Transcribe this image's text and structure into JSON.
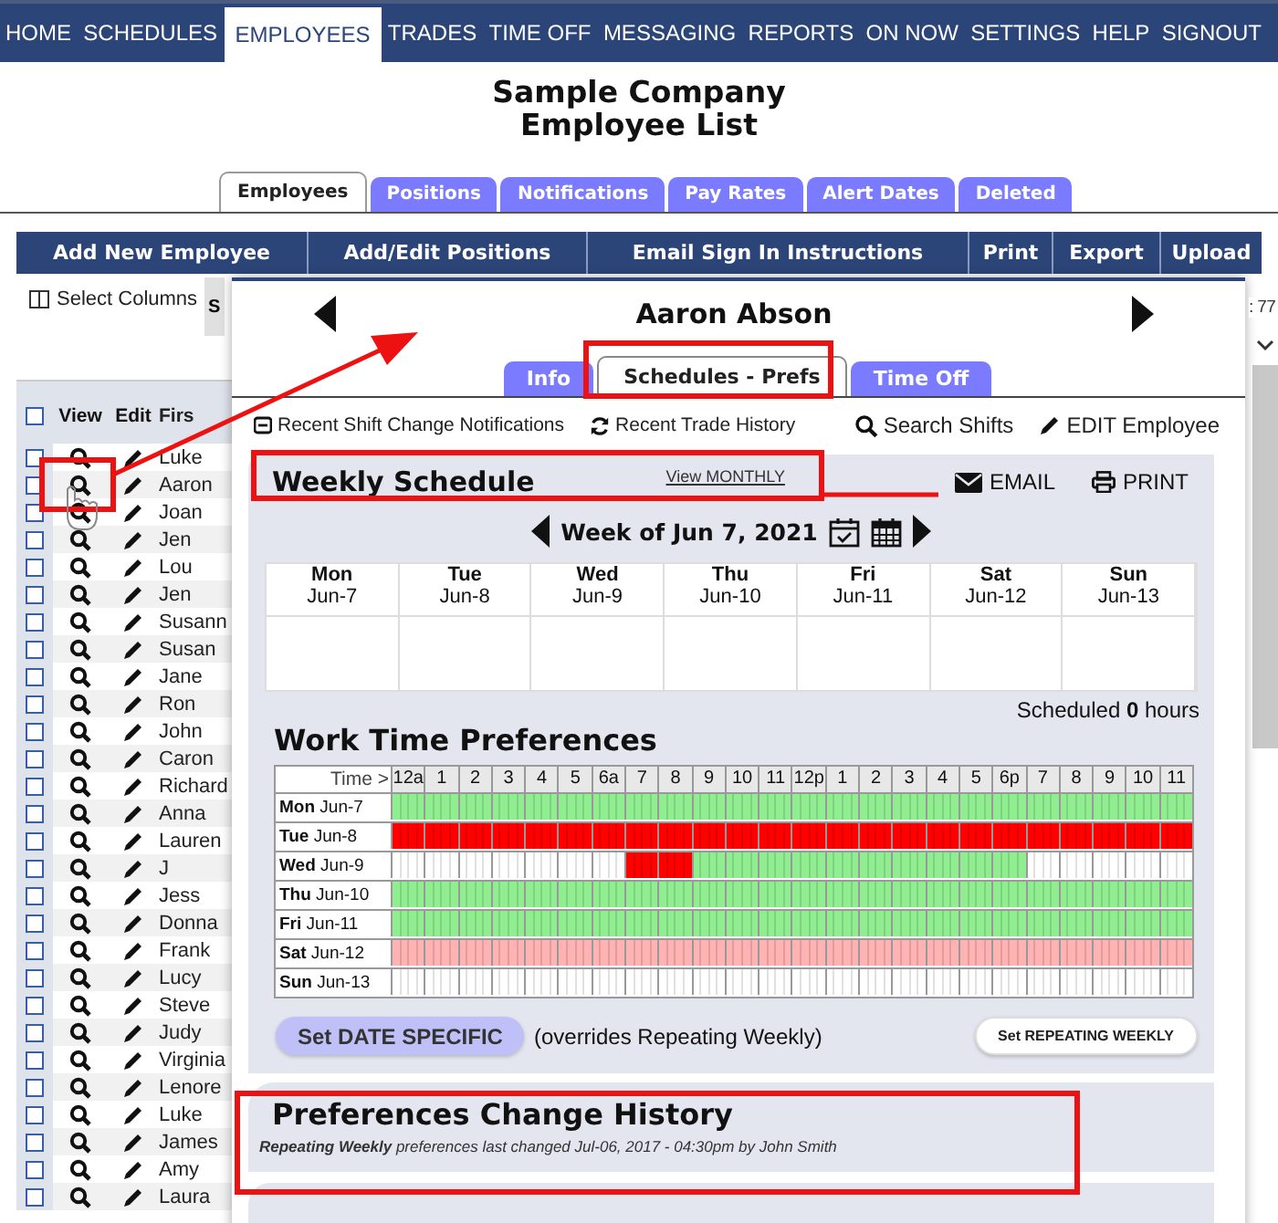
{
  "nav": [
    {
      "label": "HOME",
      "selected": false
    },
    {
      "label": "SCHEDULES",
      "selected": false
    },
    {
      "label": "EMPLOYEES",
      "selected": true
    },
    {
      "label": "TRADES",
      "selected": false
    },
    {
      "label": "TIME OFF",
      "selected": false
    },
    {
      "label": "MESSAGING",
      "selected": false
    },
    {
      "label": "REPORTS",
      "selected": false
    },
    {
      "label": "ON NOW",
      "selected": false
    },
    {
      "label": "SETTINGS",
      "selected": false
    },
    {
      "label": "HELP",
      "selected": false
    },
    {
      "label": "SIGNOUT",
      "selected": false
    }
  ],
  "page": {
    "company": "Sample Company",
    "title": "Employee List"
  },
  "tabs": [
    {
      "label": "Employees",
      "selected": true
    },
    {
      "label": "Positions",
      "selected": false
    },
    {
      "label": "Notifications",
      "selected": false
    },
    {
      "label": "Pay Rates",
      "selected": false
    },
    {
      "label": "Alert Dates",
      "selected": false
    },
    {
      "label": "Deleted",
      "selected": false
    }
  ],
  "toolbar": [
    "Add New Employee",
    "Add/Edit Positions",
    "Email Sign In Instructions",
    "Print",
    "Export",
    "Upload"
  ],
  "select_columns": "Select Columns",
  "cut_button": "S",
  "count_fragment": ": 77",
  "employees": {
    "columns": [
      "View",
      "Edit",
      "Firs"
    ],
    "all_checked": false,
    "rows": [
      {
        "first": "Luke",
        "checked": false
      },
      {
        "first": "Aaron",
        "checked": false
      },
      {
        "first": "Joan",
        "checked": false
      },
      {
        "first": "Jen",
        "checked": false
      },
      {
        "first": "Lou",
        "checked": false
      },
      {
        "first": "Jen",
        "checked": false
      },
      {
        "first": "Susann",
        "checked": false
      },
      {
        "first": "Susan",
        "checked": false
      },
      {
        "first": "Jane",
        "checked": false
      },
      {
        "first": "Ron",
        "checked": false
      },
      {
        "first": "John",
        "checked": false
      },
      {
        "first": "Caron",
        "checked": false
      },
      {
        "first": "Richard",
        "checked": false
      },
      {
        "first": "Anna",
        "checked": false
      },
      {
        "first": "Lauren",
        "checked": false
      },
      {
        "first": "J",
        "checked": false
      },
      {
        "first": "Jess",
        "checked": false
      },
      {
        "first": "Donna",
        "checked": false
      },
      {
        "first": "Frank",
        "checked": false
      },
      {
        "first": "Lucy",
        "checked": false
      },
      {
        "first": "Steve",
        "checked": false
      },
      {
        "first": "Judy",
        "checked": false
      },
      {
        "first": "Virginia",
        "checked": false
      },
      {
        "first": "Lenore",
        "checked": false
      },
      {
        "first": "Luke",
        "checked": false
      },
      {
        "first": "James",
        "checked": false
      },
      {
        "first": "Amy",
        "checked": false
      },
      {
        "first": "Laura",
        "checked": false
      }
    ]
  },
  "popup": {
    "name": "Aaron Abson",
    "tabs": [
      {
        "label": "Info",
        "selected": false
      },
      {
        "label": "Schedules - Prefs",
        "selected": true
      },
      {
        "label": "Time Off",
        "selected": false
      }
    ],
    "links": [
      {
        "kind": "notification",
        "label": "Recent Shift Change Notifications"
      },
      {
        "kind": "refresh",
        "label": "Recent Trade History"
      },
      {
        "kind": "search",
        "label": "Search Shifts"
      },
      {
        "kind": "edit",
        "label": "EDIT Employee"
      }
    ],
    "weekly": {
      "title": "Weekly Schedule",
      "view_link": "View MONTHLY",
      "actions": [
        {
          "kind": "email",
          "label": "EMAIL"
        },
        {
          "kind": "print",
          "label": "PRINT"
        }
      ],
      "week": "Week of Jun 7, 2021",
      "days": [
        {
          "day": "Mon",
          "date": "Jun-7"
        },
        {
          "day": "Tue",
          "date": "Jun-8"
        },
        {
          "day": "Wed",
          "date": "Jun-9"
        },
        {
          "day": "Thu",
          "date": "Jun-10"
        },
        {
          "day": "Fri",
          "date": "Jun-11"
        },
        {
          "day": "Sat",
          "date": "Jun-12"
        },
        {
          "day": "Sun",
          "date": "Jun-13"
        }
      ],
      "scheduled": "Scheduled **0** hours"
    },
    "preferences": {
      "title": "Work Time Preferences",
      "corner": "Time >",
      "hours": [
        "12a",
        "1",
        "2",
        "3",
        "4",
        "5",
        "6a",
        "7",
        "8",
        "9",
        "10",
        "11",
        "12p",
        "1",
        "2",
        "3",
        "4",
        "5",
        "6p",
        "7",
        "8",
        "9",
        "10",
        "11"
      ],
      "rows": [
        {
          "day": "Mon",
          "date": "Jun-7",
          "slots": [
            {
              "color": "#90ee90"
            },
            {
              "color": "#90ee90"
            },
            {
              "color": "#90ee90"
            },
            {
              "color": "#90ee90"
            },
            {
              "color": "#90ee90"
            },
            {
              "color": "#90ee90"
            },
            {
              "color": "#90ee90"
            },
            {
              "color": "#90ee90"
            },
            {
              "color": "#90ee90"
            },
            {
              "color": "#90ee90"
            },
            {
              "color": "#90ee90"
            },
            {
              "color": "#90ee90"
            },
            {
              "color": "#90ee90"
            },
            {
              "color": "#90ee90"
            },
            {
              "color": "#90ee90"
            },
            {
              "color": "#90ee90"
            },
            {
              "color": "#90ee90"
            },
            {
              "color": "#90ee90"
            },
            {
              "color": "#90ee90"
            },
            {
              "color": "#90ee90"
            },
            {
              "color": "#90ee90"
            },
            {
              "color": "#90ee90"
            },
            {
              "color": "#90ee90"
            },
            {
              "color": "#90ee90"
            }
          ]
        },
        {
          "day": "Tue",
          "date": "Jun-8",
          "slots": [
            {
              "color": "#ff0000"
            },
            {
              "color": "#ff0000"
            },
            {
              "color": "#ff0000"
            },
            {
              "color": "#ff0000"
            },
            {
              "color": "#ff0000"
            },
            {
              "color": "#ff0000"
            },
            {
              "color": "#ff0000"
            },
            {
              "color": "#ff0000"
            },
            {
              "color": "#ff0000"
            },
            {
              "color": "#ff0000"
            },
            {
              "color": "#ff0000"
            },
            {
              "color": "#ff0000"
            },
            {
              "color": "#ff0000"
            },
            {
              "color": "#ff0000"
            },
            {
              "color": "#ff0000"
            },
            {
              "color": "#ff0000"
            },
            {
              "color": "#ff0000"
            },
            {
              "color": "#ff0000"
            },
            {
              "color": "#ff0000"
            },
            {
              "color": "#ff0000"
            },
            {
              "color": "#ff0000"
            },
            {
              "color": "#ff0000"
            },
            {
              "color": "#ff0000"
            },
            {
              "color": "#ff0000"
            }
          ]
        },
        {
          "day": "Wed",
          "date": "Jun-9",
          "slots": [
            {
              "color": "#ffffff"
            },
            {
              "color": "#ffffff"
            },
            {
              "color": "#ffffff"
            },
            {
              "color": "#ffffff"
            },
            {
              "color": "#ffffff"
            },
            {
              "color": "#ffffff"
            },
            {
              "color": "#ffffff"
            },
            {
              "color": "#ff0000"
            },
            {
              "color": "#ff0000"
            },
            {
              "color": "#90ee90"
            },
            {
              "color": "#90ee90"
            },
            {
              "color": "#90ee90"
            },
            {
              "color": "#90ee90"
            },
            {
              "color": "#90ee90"
            },
            {
              "color": "#90ee90"
            },
            {
              "color": "#90ee90"
            },
            {
              "color": "#90ee90"
            },
            {
              "color": "#90ee90"
            },
            {
              "color": "#90ee90"
            },
            {
              "color": "#ffffff"
            },
            {
              "color": "#ffffff"
            },
            {
              "color": "#ffffff"
            },
            {
              "color": "#ffffff"
            },
            {
              "color": "#ffffff"
            }
          ]
        },
        {
          "day": "Thu",
          "date": "Jun-10",
          "slots": [
            {
              "color": "#90ee90"
            },
            {
              "color": "#90ee90"
            },
            {
              "color": "#90ee90"
            },
            {
              "color": "#90ee90"
            },
            {
              "color": "#90ee90"
            },
            {
              "color": "#90ee90"
            },
            {
              "color": "#90ee90"
            },
            {
              "color": "#90ee90"
            },
            {
              "color": "#90ee90"
            },
            {
              "color": "#90ee90"
            },
            {
              "color": "#90ee90"
            },
            {
              "color": "#90ee90"
            },
            {
              "color": "#90ee90"
            },
            {
              "color": "#90ee90"
            },
            {
              "color": "#90ee90"
            },
            {
              "color": "#90ee90"
            },
            {
              "color": "#90ee90"
            },
            {
              "color": "#90ee90"
            },
            {
              "color": "#90ee90"
            },
            {
              "color": "#90ee90"
            },
            {
              "color": "#90ee90"
            },
            {
              "color": "#90ee90"
            },
            {
              "color": "#90ee90"
            },
            {
              "color": "#90ee90"
            }
          ]
        },
        {
          "day": "Fri",
          "date": "Jun-11",
          "slots": [
            {
              "color": "#90ee90"
            },
            {
              "color": "#90ee90"
            },
            {
              "color": "#90ee90"
            },
            {
              "color": "#90ee90"
            },
            {
              "color": "#90ee90"
            },
            {
              "color": "#90ee90"
            },
            {
              "color": "#90ee90"
            },
            {
              "color": "#90ee90"
            },
            {
              "color": "#90ee90"
            },
            {
              "color": "#90ee90"
            },
            {
              "color": "#90ee90"
            },
            {
              "color": "#90ee90"
            },
            {
              "color": "#90ee90"
            },
            {
              "color": "#90ee90"
            },
            {
              "color": "#90ee90"
            },
            {
              "color": "#90ee90"
            },
            {
              "color": "#90ee90"
            },
            {
              "color": "#90ee90"
            },
            {
              "color": "#90ee90"
            },
            {
              "color": "#90ee90"
            },
            {
              "color": "#90ee90"
            },
            {
              "color": "#90ee90"
            },
            {
              "color": "#90ee90"
            },
            {
              "color": "#90ee90"
            }
          ]
        },
        {
          "day": "Sat",
          "date": "Jun-12",
          "slots": [
            {
              "color": "#ffb3b3"
            },
            {
              "color": "#ffb3b3"
            },
            {
              "color": "#ffb3b3"
            },
            {
              "color": "#ffb3b3"
            },
            {
              "color": "#ffb3b3"
            },
            {
              "color": "#ffb3b3"
            },
            {
              "color": "#ffb3b3"
            },
            {
              "color": "#ffb3b3"
            },
            {
              "color": "#ffb3b3"
            },
            {
              "color": "#ffb3b3"
            },
            {
              "color": "#ffb3b3"
            },
            {
              "color": "#ffb3b3"
            },
            {
              "color": "#ffb3b3"
            },
            {
              "color": "#ffb3b3"
            },
            {
              "color": "#ffb3b3"
            },
            {
              "color": "#ffb3b3"
            },
            {
              "color": "#ffb3b3"
            },
            {
              "color": "#ffb3b3"
            },
            {
              "color": "#ffb3b3"
            },
            {
              "color": "#ffb3b3"
            },
            {
              "color": "#ffb3b3"
            },
            {
              "color": "#ffb3b3"
            },
            {
              "color": "#ffb3b3"
            },
            {
              "color": "#ffb3b3"
            }
          ]
        },
        {
          "day": "Sun",
          "date": "Jun-13",
          "slots": [
            {
              "color": "#ffffff"
            },
            {
              "color": "#ffffff"
            },
            {
              "color": "#ffffff"
            },
            {
              "color": "#ffffff"
            },
            {
              "color": "#ffffff"
            },
            {
              "color": "#ffffff"
            },
            {
              "color": "#ffffff"
            },
            {
              "color": "#ffffff"
            },
            {
              "color": "#ffffff"
            },
            {
              "color": "#ffffff"
            },
            {
              "color": "#ffffff"
            },
            {
              "color": "#ffffff"
            },
            {
              "color": "#ffffff"
            },
            {
              "color": "#ffffff"
            },
            {
              "color": "#ffffff"
            },
            {
              "color": "#ffffff"
            },
            {
              "color": "#ffffff"
            },
            {
              "color": "#ffffff"
            },
            {
              "color": "#ffffff"
            },
            {
              "color": "#ffffff"
            },
            {
              "color": "#ffffff"
            },
            {
              "color": "#ffffff"
            },
            {
              "color": "#ffffff"
            },
            {
              "color": "#ffffff"
            }
          ]
        }
      ]
    },
    "date_specific_button": "Set DATE SPECIFIC",
    "overrides_note": "(overrides Repeating Weekly)",
    "repeating_button": "Set REPEATING WEEKLY",
    "history": {
      "title": "Preferences Change History",
      "entry": "**Repeating Weekly** preferences last changed Jul-06, 2017 - 04:30pm by John Smith"
    }
  }
}
